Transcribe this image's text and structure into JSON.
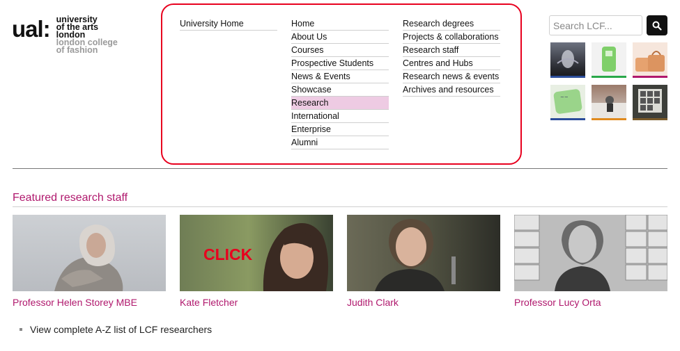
{
  "logo": {
    "mark": "ual:",
    "line1": "university",
    "line2": "of the arts",
    "line3": "london",
    "line4": "london college",
    "line5": "of fashion"
  },
  "nav": {
    "col1": [
      "University Home"
    ],
    "col2": [
      "Home",
      "About Us",
      "Courses",
      "Prospective Students",
      "News & Events",
      "Showcase",
      "Research",
      "International",
      "Enterprise",
      "Alumni"
    ],
    "col3": [
      "Research degrees",
      "Projects & collaborations",
      "Research staff",
      "Centres and Hubs",
      "Research news & events",
      "Archives and resources"
    ],
    "active": "Research"
  },
  "search": {
    "placeholder": "Search LCF..."
  },
  "colors": {
    "accent": "#b0186d",
    "highlight": "#e8001e",
    "active_bg": "#eecbe3"
  },
  "featured": {
    "title": "Featured research staff",
    "people": [
      {
        "name": "Professor Helen Storey MBE"
      },
      {
        "name": "Kate Fletcher",
        "overlay": "CLICK"
      },
      {
        "name": "Judith Clark"
      },
      {
        "name": "Professor Lucy Orta"
      }
    ]
  },
  "links": {
    "az_list": "View complete A-Z list of LCF researchers"
  }
}
